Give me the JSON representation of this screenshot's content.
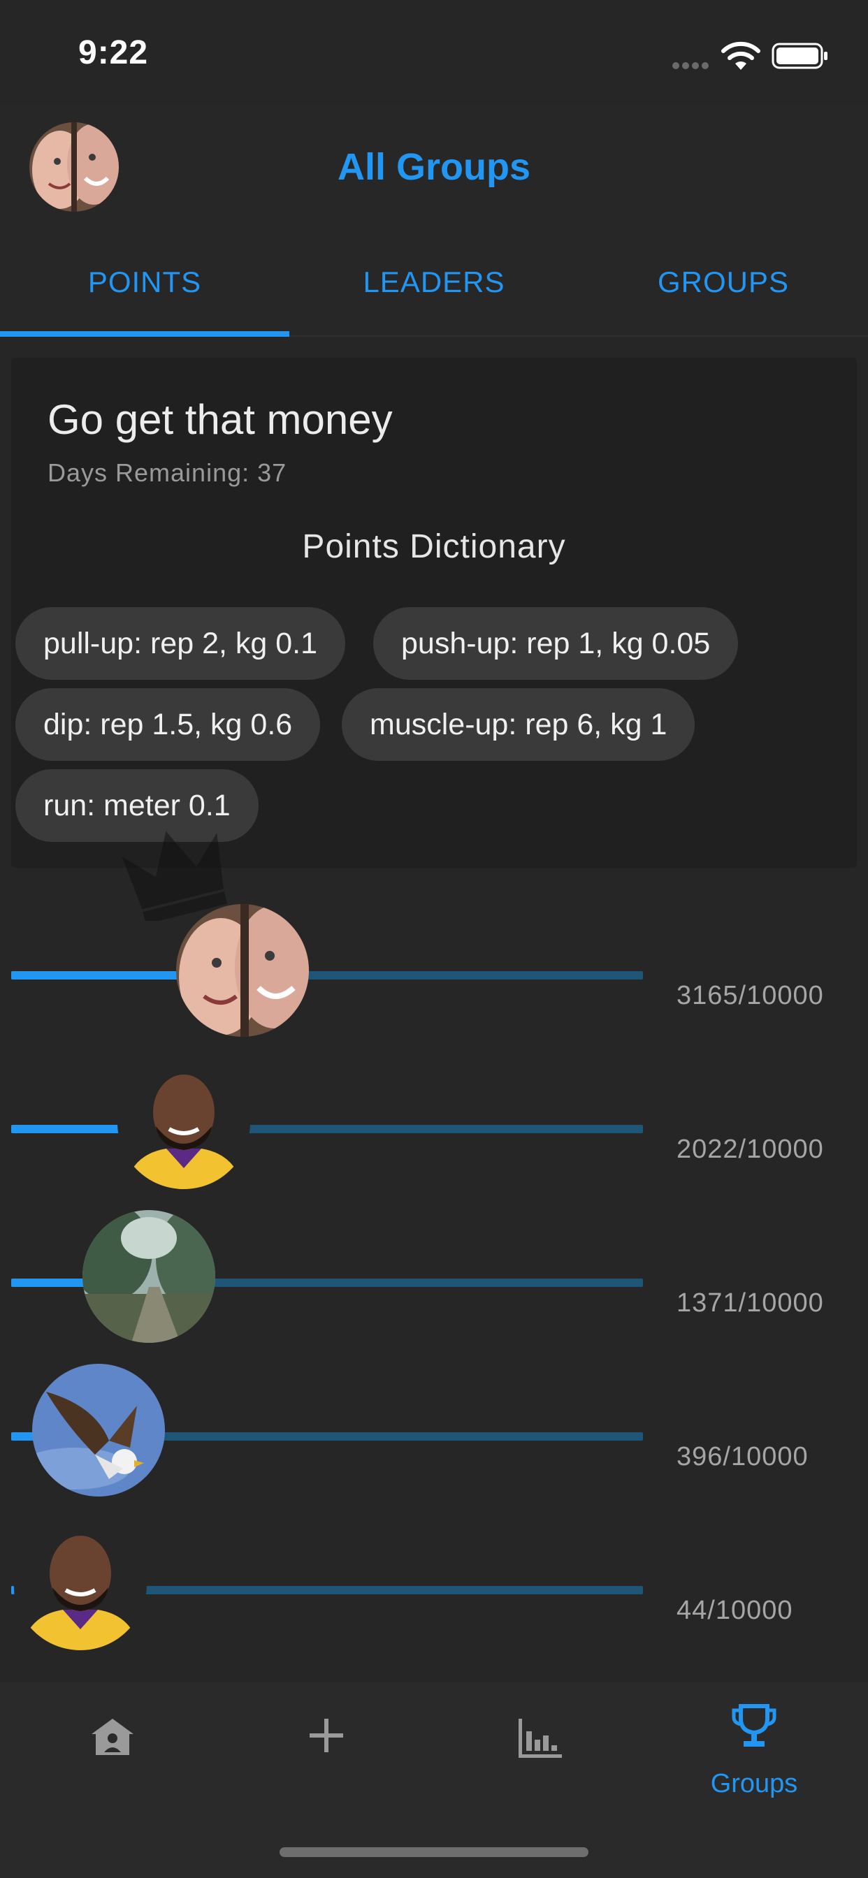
{
  "status_bar": {
    "time": "9:22"
  },
  "header": {
    "title": "All Groups"
  },
  "tabs": [
    {
      "label": "POINTS"
    },
    {
      "label": "LEADERS"
    },
    {
      "label": "GROUPS"
    }
  ],
  "card": {
    "title": "Go get that money",
    "days_remaining": "Days Remaining: 37",
    "dictionary_title": "Points Dictionary",
    "chips": [
      "pull-up: rep 2, kg 0.1",
      "push-up: rep 1, kg 0.05",
      "dip: rep 1.5, kg 0.6",
      "muscle-up: rep 6, kg 1",
      "run: meter 0.1"
    ]
  },
  "leaderboard": [
    {
      "score": "3165/10000",
      "progress": 0.3165,
      "avatar": "couple-photo"
    },
    {
      "score": "2022/10000",
      "progress": 0.2022,
      "avatar": "player-photo"
    },
    {
      "score": "1371/10000",
      "progress": 0.1371,
      "avatar": "forest-photo"
    },
    {
      "score": "396/10000",
      "progress": 0.0396,
      "avatar": "eagle-photo"
    },
    {
      "score": "44/10000",
      "progress": 0.0044,
      "avatar": "player-photo"
    }
  ],
  "bottom_nav": {
    "items": [
      {
        "icon": "home-icon",
        "label": ""
      },
      {
        "icon": "plus-icon",
        "label": ""
      },
      {
        "icon": "bar-chart-icon",
        "label": ""
      },
      {
        "icon": "trophy-icon",
        "label": "Groups"
      }
    ]
  },
  "colors": {
    "accent": "#2196f3",
    "track": "#1f5577",
    "background": "#262626",
    "card": "#202020",
    "chip": "#3a3a3a"
  }
}
